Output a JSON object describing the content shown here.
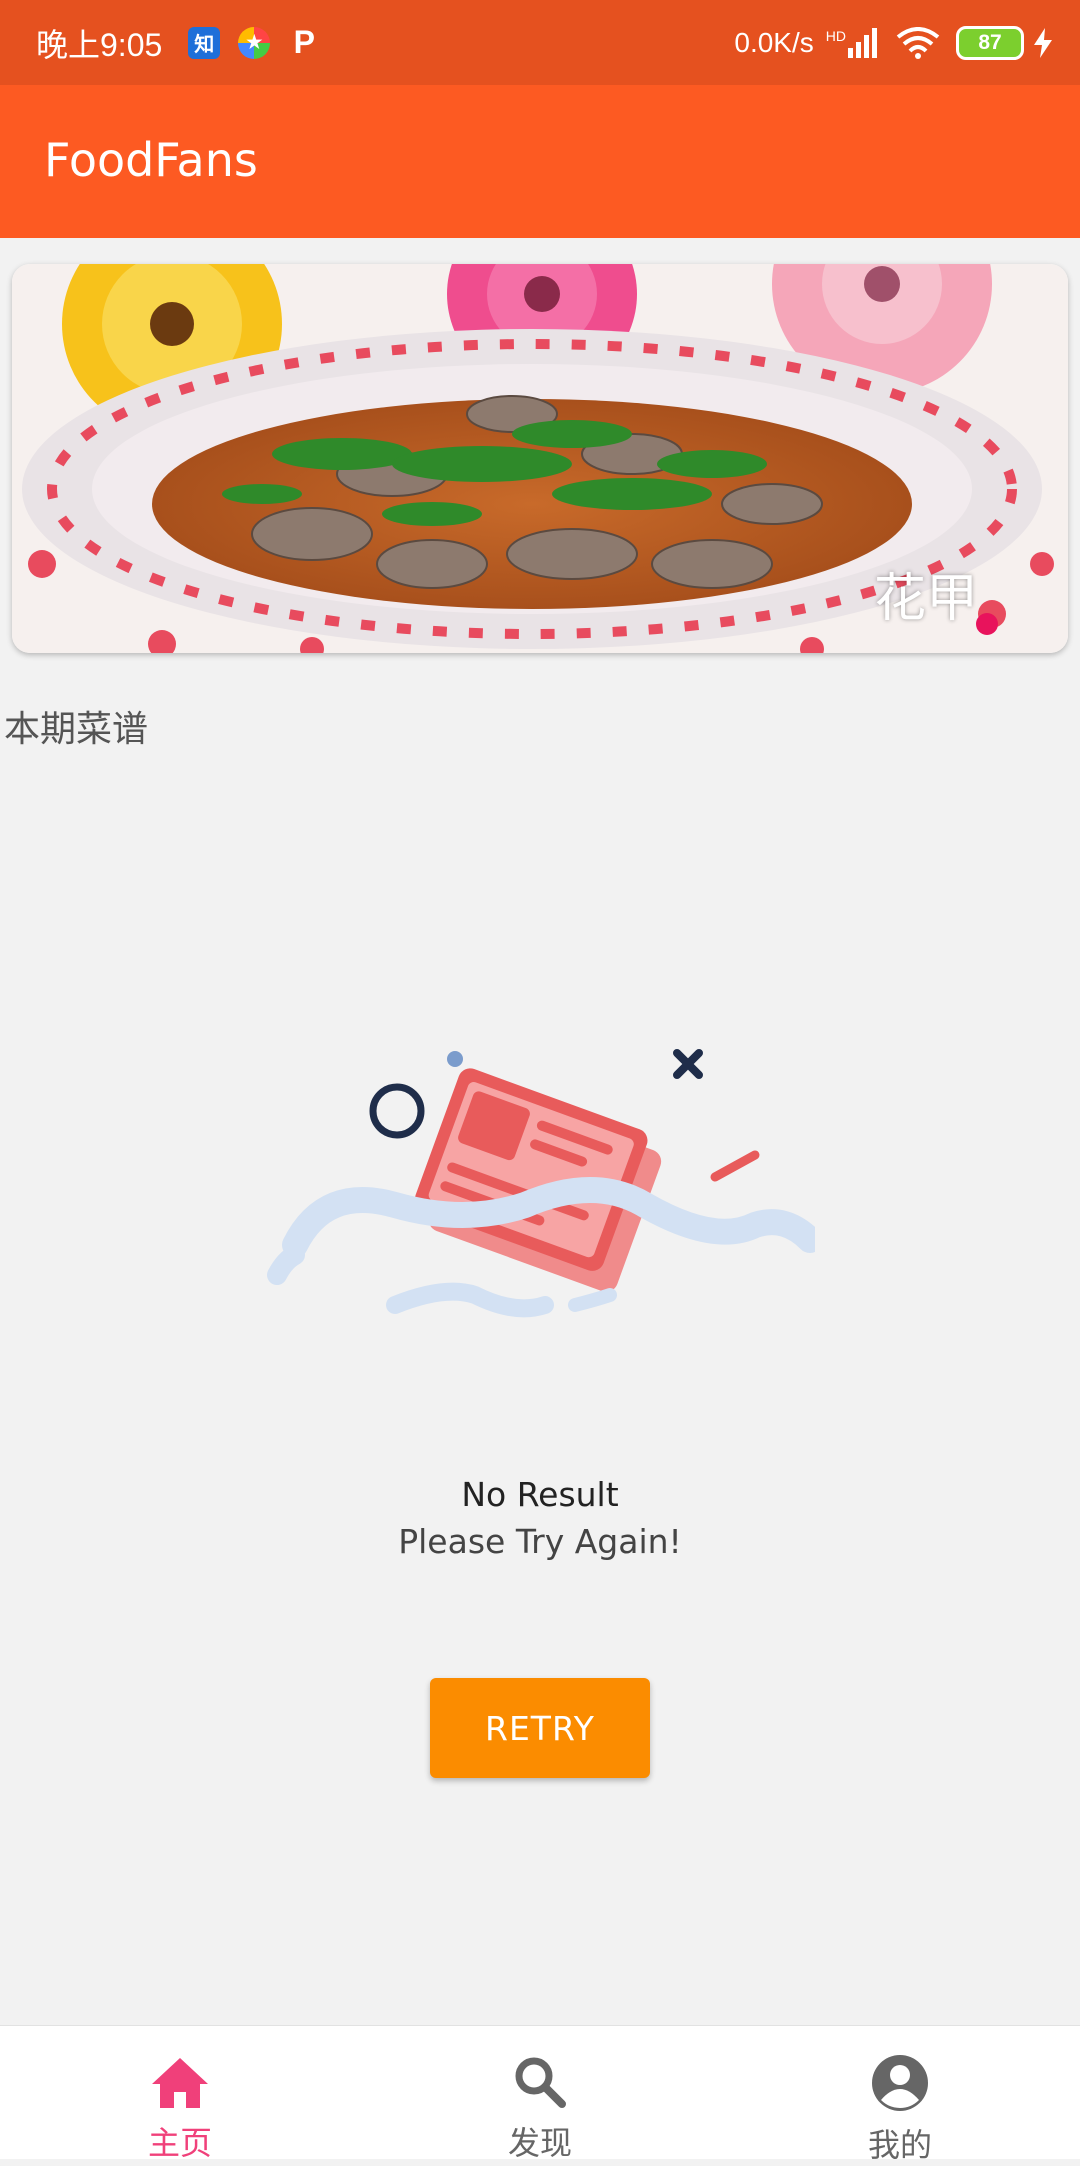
{
  "status_bar": {
    "time": "晚上9:05",
    "app_icons": [
      "zhihu-icon",
      "star-app-icon",
      "p-app-icon"
    ],
    "p_glyph": "P",
    "zhihu_glyph": "知",
    "net_speed": "0.0K/s",
    "signal": "HD",
    "battery": "87"
  },
  "app_bar": {
    "title": "FoodFans"
  },
  "banner": {
    "watermark": "花甲"
  },
  "section": {
    "title": "本期菜谱"
  },
  "empty_state": {
    "title": "No Result",
    "subtitle": "Please Try Again!",
    "retry_label": "RETRY"
  },
  "bottom_nav": {
    "items": [
      {
        "label": "主页",
        "icon": "home-icon",
        "active": true
      },
      {
        "label": "发现",
        "icon": "search-icon",
        "active": false
      },
      {
        "label": "我的",
        "icon": "account-icon",
        "active": false
      }
    ]
  },
  "colors": {
    "status_bar": "#e5511f",
    "app_bar": "#fd5a22",
    "accent": "#f0407a",
    "retry_button": "#fb8c00"
  }
}
